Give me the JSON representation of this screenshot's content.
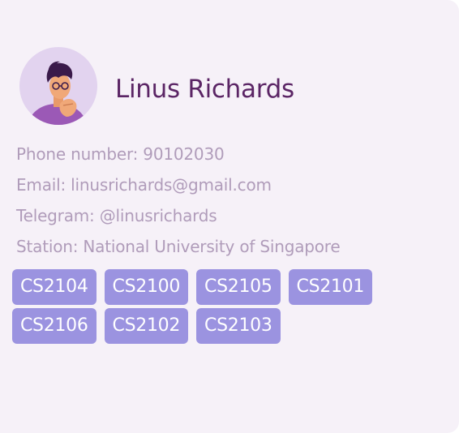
{
  "profile": {
    "name": "Linus Richards",
    "avatar_icon": "person-avatar-icon",
    "details": [
      "Phone number: 90102030",
      "Email: linusrichards@gmail.com",
      "Telegram: @linusrichards",
      "Station: National University of Singapore"
    ],
    "tag_rows": [
      [
        "CS2104",
        "CS2100",
        "CS2105",
        "CS2101"
      ],
      [
        "CS2106",
        "CS2102",
        "CS2103"
      ]
    ]
  },
  "colors": {
    "card_background": "#f6f1f8",
    "name_text": "#5b2565",
    "detail_text": "#b09cba",
    "tag_background": "#9b93e0",
    "tag_text": "#ffffff",
    "avatar_background": "#e2d3ef"
  }
}
